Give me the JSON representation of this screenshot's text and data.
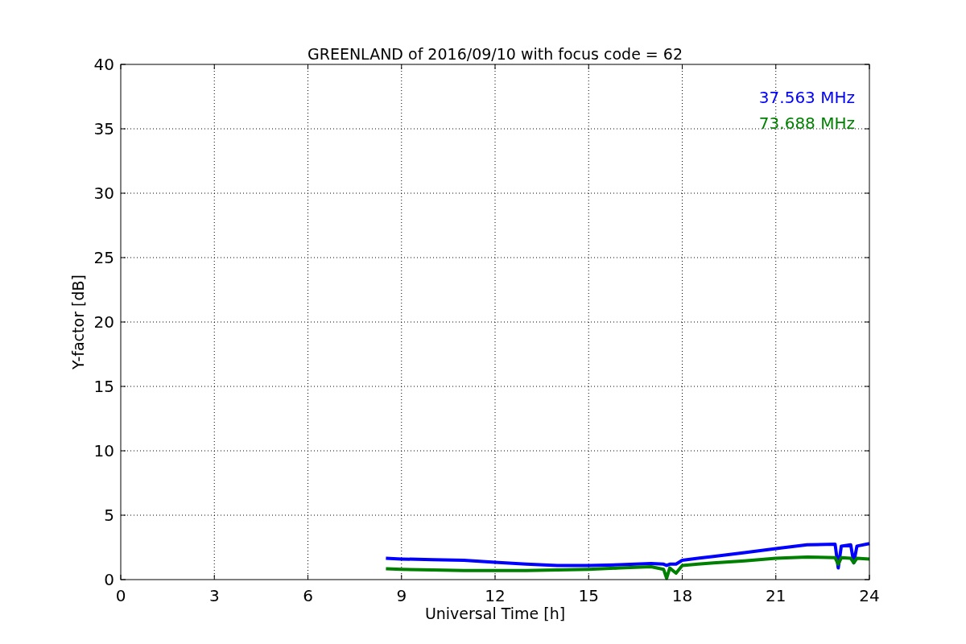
{
  "chart_data": {
    "type": "line",
    "title": "GREENLAND of 2016/09/10 with focus code = 62",
    "xlabel": "Universal Time [h]",
    "ylabel": "Y-factor [dB]",
    "x": [
      8.5,
      9,
      10,
      11,
      12,
      13,
      14,
      15,
      16,
      17,
      17.4,
      17.5,
      17.6,
      17.8,
      18,
      18.5,
      19,
      20,
      21,
      22,
      22.9,
      23,
      23.1,
      23.4,
      23.5,
      23.6,
      24
    ],
    "series": [
      {
        "name": "37.563 MHz",
        "color": "#0000ff",
        "values": [
          1.65,
          1.6,
          1.55,
          1.5,
          1.35,
          1.2,
          1.1,
          1.1,
          1.15,
          1.25,
          1.2,
          1.1,
          1.2,
          1.2,
          1.5,
          1.65,
          1.8,
          2.1,
          2.4,
          2.7,
          2.75,
          0.9,
          2.6,
          2.7,
          1.3,
          2.6,
          2.8
        ]
      },
      {
        "name": "73.688 MHz",
        "color": "#008000",
        "values": [
          0.85,
          0.8,
          0.75,
          0.7,
          0.7,
          0.7,
          0.75,
          0.8,
          0.9,
          1.0,
          0.8,
          0.1,
          0.9,
          0.5,
          1.1,
          1.2,
          1.3,
          1.45,
          1.65,
          1.75,
          1.7,
          1.2,
          1.7,
          1.65,
          1.3,
          1.65,
          1.6
        ]
      }
    ],
    "xlim": [
      0,
      24
    ],
    "ylim": [
      0,
      40
    ],
    "xticks": [
      0,
      3,
      6,
      9,
      12,
      15,
      18,
      21,
      24
    ],
    "yticks": [
      0,
      5,
      10,
      15,
      20,
      25,
      30,
      35,
      40
    ],
    "grid": true
  }
}
